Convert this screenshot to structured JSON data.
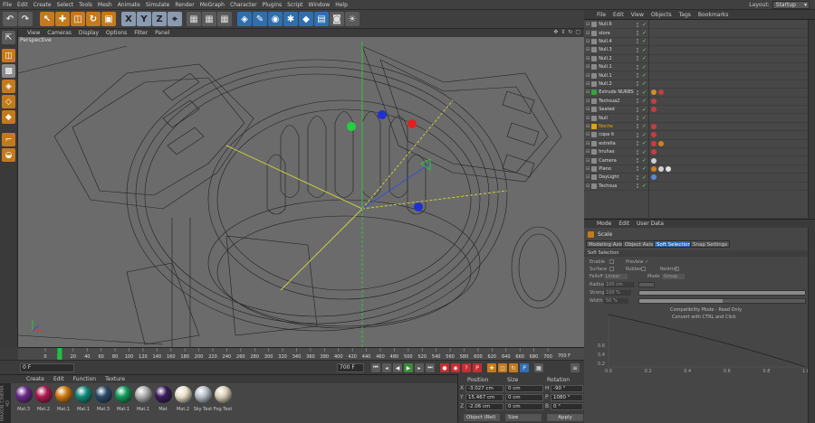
{
  "menubar": {
    "items": [
      "File",
      "Edit",
      "Create",
      "Select",
      "Tools",
      "Mesh",
      "Animate",
      "Simulate",
      "Render",
      "MoGraph",
      "Character",
      "Plugins",
      "Script",
      "Window",
      "Help"
    ],
    "layout_label": "Layout:",
    "layout_value": "Startup"
  },
  "viewport": {
    "menu": [
      "View",
      "Cameras",
      "Display",
      "Options",
      "Filter",
      "Panel"
    ],
    "label": "Perspective"
  },
  "timeline": {
    "ticks": [
      "0",
      "10",
      "20",
      "40",
      "60",
      "80",
      "100",
      "120",
      "140",
      "160",
      "180",
      "200",
      "220",
      "240",
      "260",
      "280",
      "300",
      "320",
      "340",
      "360",
      "380",
      "400",
      "420",
      "440",
      "460",
      "480",
      "500",
      "520",
      "540",
      "560",
      "580",
      "600",
      "620",
      "640",
      "660",
      "680",
      "700"
    ],
    "frame_end": "700 F",
    "current": "10 F",
    "start_field": "0 F",
    "end_field": "700 F"
  },
  "material_manager": {
    "menu": [
      "Create",
      "Edit",
      "Function",
      "Texture"
    ],
    "brand": "MAXON CINEMA 4D",
    "materials": [
      {
        "name": "Mat.3",
        "color": "#6a2a8a"
      },
      {
        "name": "Mat.2",
        "color": "#b01850"
      },
      {
        "name": "Mat.1",
        "color": "#d07a10"
      },
      {
        "name": "Mat.1",
        "color": "#108a7a"
      },
      {
        "name": "Mat.3",
        "color": "#2a4a6a"
      },
      {
        "name": "Mat.1",
        "color": "#109a5a"
      },
      {
        "name": "Mat.1",
        "color": "#b0b0b0"
      },
      {
        "name": "Mat",
        "color": "#3a1a5a"
      },
      {
        "name": "Mat.2",
        "color": "#e8e0c8"
      },
      {
        "name": "Sky Text",
        "color": "#b8c0c8"
      },
      {
        "name": "Fog Text",
        "color": "#d8d0b8"
      }
    ]
  },
  "coordinates": {
    "headers": [
      "Position",
      "Size",
      "Rotation"
    ],
    "rows": [
      {
        "axis": "X",
        "pos": "-3.027 cm",
        "size": "0 cm",
        "rot_axis": "H",
        "rot": "-90 °"
      },
      {
        "axis": "Y",
        "pos": "15.467 cm",
        "size": "0 cm",
        "rot_axis": "P",
        "rot": "1080 °"
      },
      {
        "axis": "Z",
        "pos": "-2.06 cm",
        "size": "0 cm",
        "rot_axis": "B",
        "rot": "0 °"
      }
    ],
    "mode": "Object (Rel)",
    "size_mode": "Size",
    "apply": "Apply"
  },
  "object_manager": {
    "menu": [
      "File",
      "Edit",
      "View",
      "Objects",
      "Tags",
      "Bookmarks"
    ],
    "objects": [
      {
        "name": "Null.6",
        "icon": "#8a8a8a",
        "tags": []
      },
      {
        "name": "store",
        "icon": "#8a8a8a",
        "tags": []
      },
      {
        "name": "Null.4",
        "icon": "#8a8a8a",
        "tags": []
      },
      {
        "name": "Null.3",
        "icon": "#8a8a8a",
        "tags": []
      },
      {
        "name": "Null.2",
        "icon": "#8a8a8a",
        "tags": []
      },
      {
        "name": "Null.1",
        "icon": "#8a8a8a",
        "tags": []
      },
      {
        "name": "Null.1",
        "icon": "#8a8a8a",
        "tags": []
      },
      {
        "name": "Null.2",
        "icon": "#8a8a8a",
        "tags": []
      },
      {
        "name": "Extrude NURBS",
        "icon": "#3aa03a",
        "tags": [
          "#d09030",
          "#c04040"
        ]
      },
      {
        "name": "Techsua2",
        "icon": "#8a8a8a",
        "tags": [
          "#c04040"
        ]
      },
      {
        "name": "Seated",
        "icon": "#8a8a8a",
        "tags": [
          "#c04040"
        ]
      },
      {
        "name": "Null",
        "icon": "#8a8a8a",
        "tags": []
      },
      {
        "name": "Noche",
        "icon": "#e0a020",
        "tags": [
          "#c04040"
        ]
      },
      {
        "name": "copa lt",
        "icon": "#8a8a8a",
        "tags": [
          "#c04040"
        ]
      },
      {
        "name": "estrella",
        "icon": "#8a8a8a",
        "tags": [
          "#c04040",
          "#d08020"
        ]
      },
      {
        "name": "hruhas",
        "icon": "#8a8a8a",
        "tags": [
          "#c04040"
        ]
      },
      {
        "name": "Camera",
        "icon": "#8a8a8a",
        "tags": [
          "#d0d0d0"
        ]
      },
      {
        "name": "Plano",
        "icon": "#8a8a8a",
        "tags": [
          "#d08020",
          "#d0d0d0",
          "#e0e0e0"
        ]
      },
      {
        "name": "DayLight",
        "icon": "#8a8a8a",
        "tags": [
          "#5a8ad0"
        ]
      },
      {
        "name": "Techsua",
        "icon": "#8a8a8a",
        "tags": []
      }
    ]
  },
  "attributes": {
    "menu": [
      "Mode",
      "Edit",
      "User Data"
    ],
    "object_name": "Scale",
    "tabs": [
      "Modeling Axis",
      "Object Axis",
      "Soft Selection",
      "Snap Settings"
    ],
    "active_tab": "Soft Selection",
    "section": "Soft Selection",
    "rows": {
      "enable": "Enable",
      "preview": "Preview ✓",
      "surface": "Surface",
      "rubber": "Rubber",
      "restrict": "Restrict",
      "falloff": "Falloff",
      "falloff_val": "Linear",
      "mode": "Mode",
      "mode_val": "Group",
      "radius": "Radius",
      "radius_val": "100 cm",
      "strength": "Strength",
      "strength_val": "100 %",
      "width": "Width",
      "width_val": "50 %"
    },
    "levels": {
      "strength": 1.0,
      "width": 0.5
    },
    "note1": "Compatibility Mode - Read Only",
    "note2": "Convert with CTRL and Click",
    "graph_x_ticks": [
      "0.0",
      "0.2",
      "0.4",
      "0.6",
      "0.8",
      "1.0"
    ],
    "graph_y_ticks": [
      "0.6",
      "0.4",
      "0.2"
    ]
  }
}
